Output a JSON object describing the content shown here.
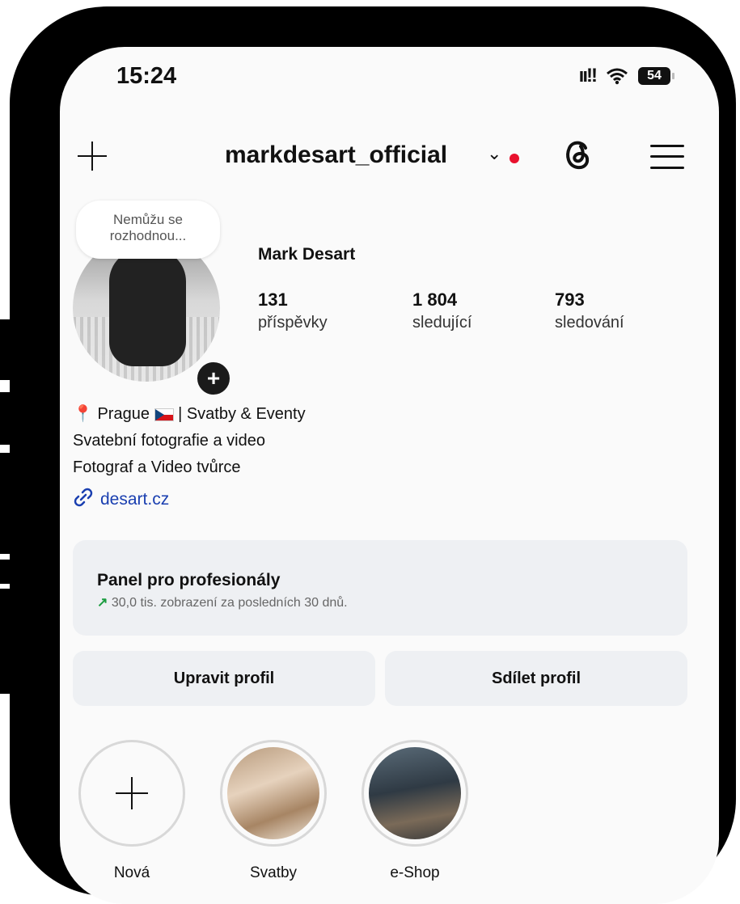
{
  "status": {
    "time": "15:24",
    "battery": "54"
  },
  "header": {
    "username": "markdesart_official",
    "chevron": "⌄"
  },
  "profile": {
    "note": "Nemůžu se rozhodnou...",
    "name": "Mark Desart",
    "stats": [
      {
        "value": "131",
        "label": "příspěvky"
      },
      {
        "value": "1 804",
        "label": "sledující"
      },
      {
        "value": "793",
        "label": "sledování"
      }
    ],
    "bio": {
      "line1_pin": "📍",
      "line1_a": "Prague",
      "line1_b": "| Svatby & Eventy",
      "line2": "Svatební fotografie a video",
      "line3": "Fotograf a Video tvůrce"
    },
    "link": "desart.cz"
  },
  "dashboard": {
    "title": "Panel pro profesionály",
    "arrow": "↗",
    "subtitle": "30,0 tis. zobrazení za posledních 30 dnů."
  },
  "buttons": {
    "edit": "Upravit profil",
    "share": "Sdílet profil"
  },
  "highlights": [
    {
      "label": "Nová"
    },
    {
      "label": "Svatby"
    },
    {
      "label": "e-Shop"
    }
  ]
}
